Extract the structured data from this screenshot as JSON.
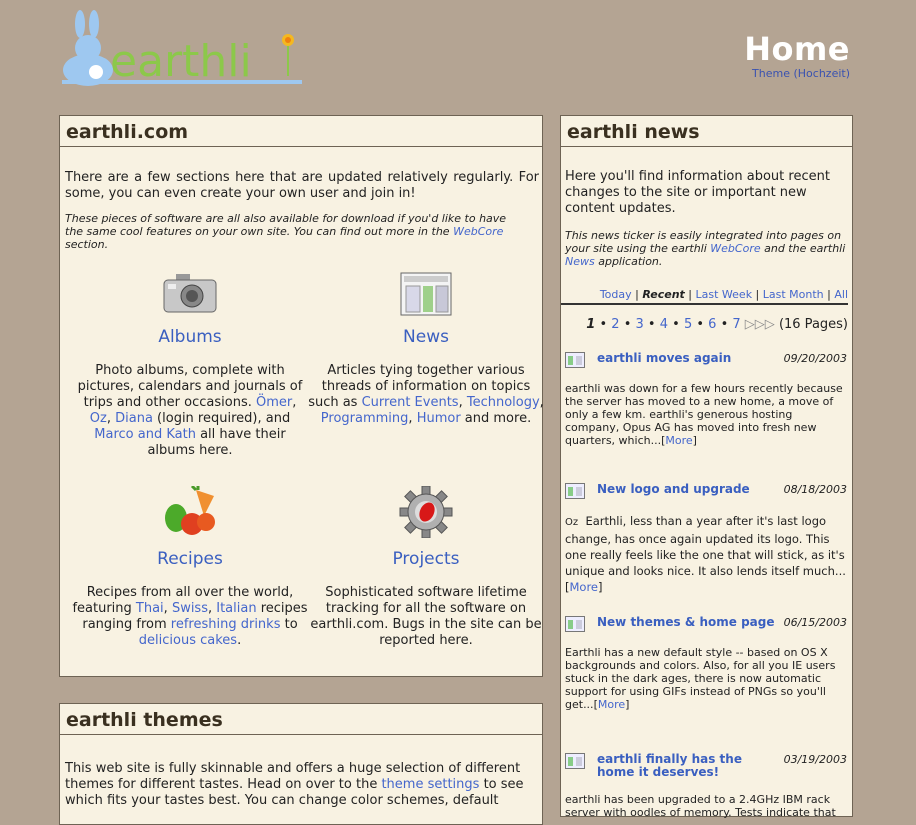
{
  "header": {
    "title": "Home",
    "theme_label": "Theme (Hochzeit)",
    "logo_text": "earthli"
  },
  "main": {
    "heading": "earthli.com",
    "intro": "There are a few sections here that are updated relatively regularly. For some, you can even create your own user and join in!",
    "software_note": "These pieces of software are all also available for download if you'd like to have the same cool features on your own site. You can find out more in the",
    "software_link": "WebCore",
    "software_note_end": "section.",
    "sections": [
      {
        "title": "Albums",
        "icon": "camera-icon",
        "parts": [
          "Photo albums, complete with pictures, calendars and journals of trips and other occasions. ",
          "Ömer",
          ", ",
          "Oz",
          ", ",
          "Diana",
          " (login required), and ",
          "Marco and Kath",
          " all have their albums here."
        ]
      },
      {
        "title": "News",
        "icon": "newspaper-icon",
        "parts": [
          "Articles tying together various threads of information on topics such as ",
          "Current Events",
          ", ",
          "Technology",
          ", ",
          "Programming",
          ", ",
          "Humor",
          " and more."
        ]
      },
      {
        "title": "Recipes",
        "icon": "vegetables-icon",
        "parts": [
          "Recipes from all over the world, featuring ",
          "Thai",
          ", ",
          "Swiss",
          ", ",
          "Italian",
          " recipes ranging from ",
          "refreshing drinks",
          " to ",
          "delicious cakes",
          "."
        ]
      },
      {
        "title": "Projects",
        "icon": "gear-bug-icon",
        "parts": [
          "Sophisticated software lifetime tracking for all the software on earthli.com. Bugs in the site can be reported here."
        ]
      }
    ]
  },
  "news": {
    "heading": "earthli news",
    "intro": "Here you'll find information about recent changes to the site or important new content updates.",
    "note_pre": "This news ticker is easily integrated into pages on your site using the earthli ",
    "note_link1": "WebCore",
    "note_mid": " and the earthli ",
    "note_link2": "News",
    "note_end": " application.",
    "filters": [
      "Today",
      "Recent",
      "Last Week",
      "Last Month",
      "All"
    ],
    "pages": [
      "1",
      "2",
      "3",
      "4",
      "5",
      "6",
      "7"
    ],
    "page_count": "(16 Pages)",
    "items": [
      {
        "title": "earthli moves again",
        "date": "09/20/2003",
        "body": "earthli was down for a few hours recently because the server has moved to a new home, a move of only a few km. earthli's generous hosting company, Opus AG has moved into fresh new quarters, which...",
        "more": "More"
      },
      {
        "title": "New logo and upgrade",
        "date": "08/18/2003",
        "author": "Oz",
        "body": "Earthli, less than a year after it's last logo change, has once again updated its logo. This one really feels like the one that will stick, as it's unique and looks nice. It also lends itself much...",
        "more": "More"
      },
      {
        "title": "New themes & home page",
        "date": "06/15/2003",
        "body": "Earthli has a new default style -- based on OS X backgrounds and colors. Also, for all you IE users stuck in the dark ages, there is now automatic support for using GIFs instead of PNGs so you'll get...",
        "more": "More"
      },
      {
        "title": "earthli finally has the home it deserves!",
        "date": "03/19/2003",
        "body": "earthli has been upgraded to a 2.4GHz IBM rack server with oodles of memory. Tests indicate that",
        "more": ""
      }
    ]
  },
  "themes": {
    "heading": "earthli themes",
    "text_pre": "This web site is fully skinnable and offers a huge selection of different themes for different tastes. Head on over to the ",
    "link": "theme settings",
    "text_post": " to see which fits your tastes best. You can change color schemes, default"
  },
  "colors": {
    "background": "#b4a493",
    "panel": "#f8f2e2",
    "link": "#4466cc",
    "border": "#6e6354"
  }
}
